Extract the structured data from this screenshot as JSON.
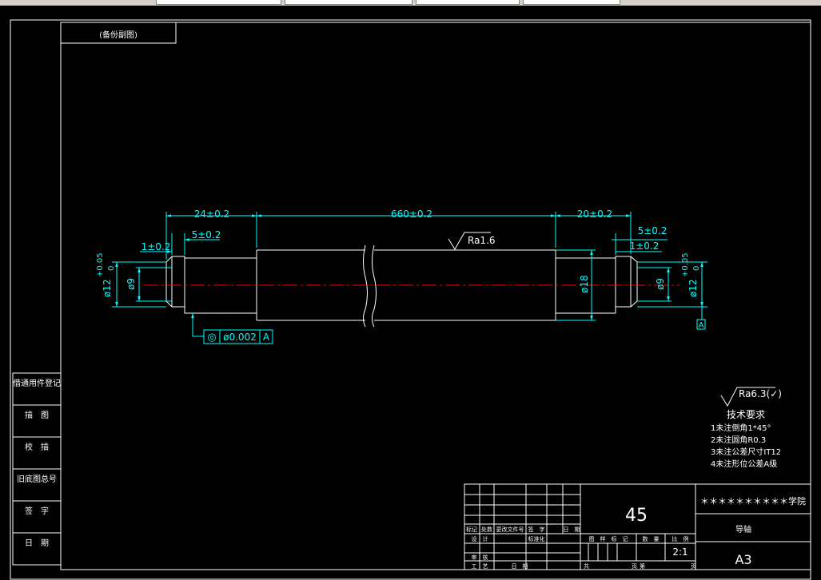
{
  "colors": {
    "background": "#000000",
    "line": "#ffffff",
    "dimension": "#00ffff",
    "centerline": "#ff0000"
  },
  "frame": {
    "title_tag": "(备份副图)",
    "side_labels": [
      "借通用件登记",
      "描　图",
      "校　描",
      "旧底图总号",
      "签　字",
      "日　期"
    ]
  },
  "dimensions": {
    "d1": "24±0.2",
    "d2": "660±0.2",
    "d3": "20±0.2",
    "d4": "1±0.2",
    "d5": "5±0.2",
    "d6": "5±0.2",
    "d7": "1±0.2",
    "dia_left_main": "ø12",
    "dia_left_tol_upper": "+0.05",
    "dia_left_tol_lower": "0",
    "dia_left_inner": "ø9",
    "dia_mid": "ø18",
    "dia_right_inner": "ø9",
    "dia_right_main": "ø12",
    "dia_right_tol_upper": "+0.05",
    "dia_right_tol_lower": "0",
    "roughness_main": "Ra1.6",
    "roughness_general": "Ra6.3(✓)",
    "tol_symbol": "◎",
    "tol_value": "ø0.002",
    "tol_datum": "A",
    "datum_tag": "A"
  },
  "tech": {
    "title": "技术要求",
    "items": [
      "1未注倒角1*45°",
      "2未注圆角R0.3",
      "3未注公差尺寸IT12",
      "4未注形位公差A级"
    ]
  },
  "title_block": {
    "material": "45",
    "school": "＊＊＊＊＊＊＊＊＊＊学院",
    "part_name": "导轴",
    "format": "A3",
    "scale": "2:1",
    "header_labels": [
      "标记",
      "处数",
      "更改文件号",
      "签　字",
      "日　期"
    ],
    "row_labels": [
      "设　计",
      "标准化",
      "审　核",
      "工　艺",
      "日　期"
    ],
    "stage_labels": [
      "图　样　标　记",
      "数　量",
      "比　例"
    ],
    "sheet_labels": [
      "共",
      "页",
      "第",
      "页"
    ]
  }
}
